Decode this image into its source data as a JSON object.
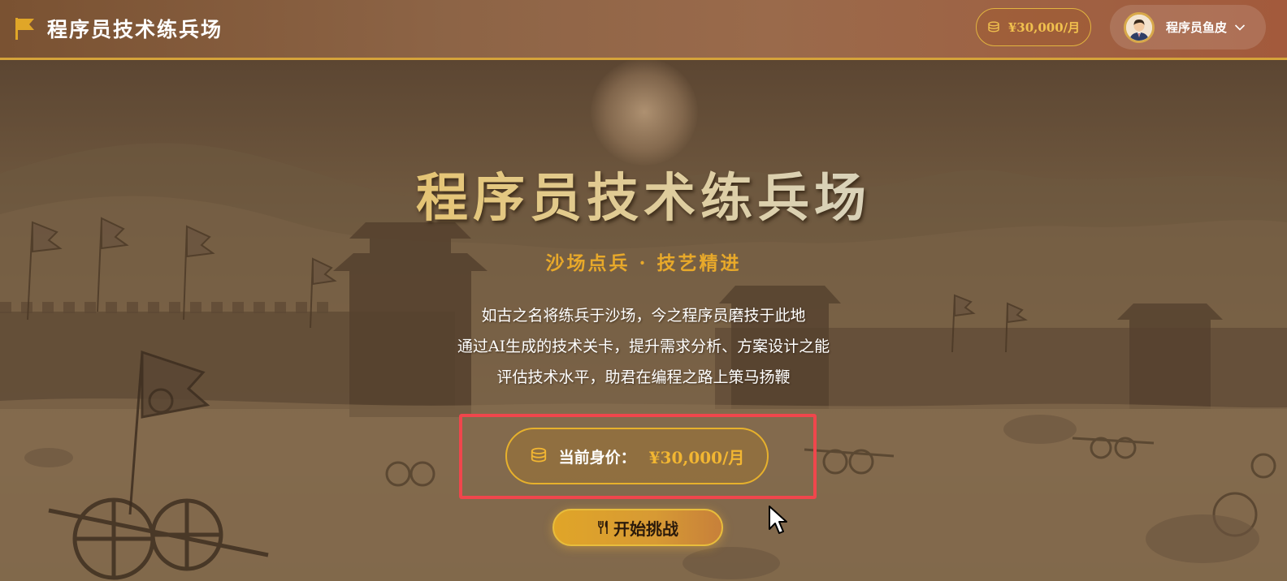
{
  "header": {
    "brand_title": "程序员技术练兵场",
    "salary_pill": "¥30,000/月",
    "user_name": "程序员鱼皮"
  },
  "hero": {
    "title": "程序员技术练兵场",
    "subtitle": "沙场点兵 · 技艺精进",
    "description_lines": [
      "如古之名将练兵于沙场，今之程序员磨技于此地",
      "通过AI生成的技术关卡，提升需求分析、方案设计之能",
      "评估技术水平，助君在编程之路上策马扬鞭"
    ],
    "worth_label": "当前身价：",
    "worth_value": "¥30,000/月",
    "start_button": "开始挑战"
  },
  "colors": {
    "accent_gold": "#e7b12c",
    "highlight_red": "#f0464c",
    "header_gradient_start": "#7a5232",
    "header_gradient_end": "#a35a3c"
  },
  "icons": [
    "flag-icon",
    "coin-stack-icon",
    "avatar-icon",
    "chevron-down-icon",
    "fork-knife-icon",
    "mouse-cursor-icon"
  ]
}
